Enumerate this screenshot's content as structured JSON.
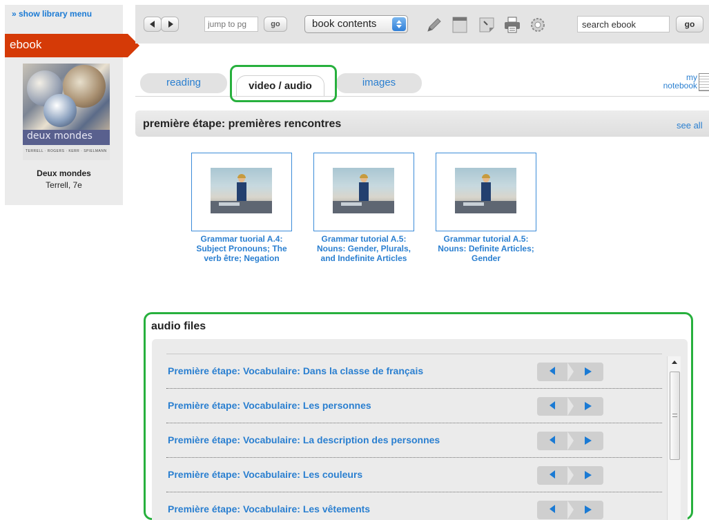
{
  "sidebar": {
    "show_library_menu": "» show library menu",
    "section_label": "ebook",
    "book_title": "Deux mondes",
    "book_author": "Terrell, 7e",
    "cover": {
      "title_text": "deux mondes",
      "authors_text": "TERRELL · ROGERS · KERR · SPIELMANN"
    }
  },
  "toolbar": {
    "jump_placeholder": "jump to pg",
    "go_label": "go",
    "contents_select": "book contents",
    "search_value": "search ebook",
    "search_go_label": "go",
    "icons": [
      "pencil-icon",
      "page-icon",
      "sticky-note-icon",
      "print-icon",
      "settings-gear-icon"
    ]
  },
  "tabs": {
    "reading": "reading",
    "video_audio": "video / audio",
    "images": "images",
    "notebook_line1": "my",
    "notebook_line2": "notebook"
  },
  "section": {
    "title": "première étape: premières rencontres",
    "see_all": "see all"
  },
  "videos": [
    {
      "caption": "Grammar tuorial A.4: Subject Pronouns; The verb être; Negation"
    },
    {
      "caption": "Grammar tutorial A.5: Nouns: Gender, Plurals, and Indefinite Articles"
    },
    {
      "caption": "Grammar tutorial A.5: Nouns: Definite Articles; Gender"
    }
  ],
  "audio": {
    "title": "audio files",
    "items": [
      {
        "label": "Première étape: Vocabulaire: Dans la classe de français"
      },
      {
        "label": "Première étape: Vocabulaire: Les personnes"
      },
      {
        "label": "Première étape: Vocabulaire: La description des personnes"
      },
      {
        "label": "Première étape: Vocabulaire: Les couleurs"
      },
      {
        "label": "Première étape: Vocabulaire: Les vêtements"
      }
    ]
  },
  "colors": {
    "accent_red": "#d53a07",
    "link_blue": "#2a7fd0",
    "highlight_green": "#27b03d"
  }
}
